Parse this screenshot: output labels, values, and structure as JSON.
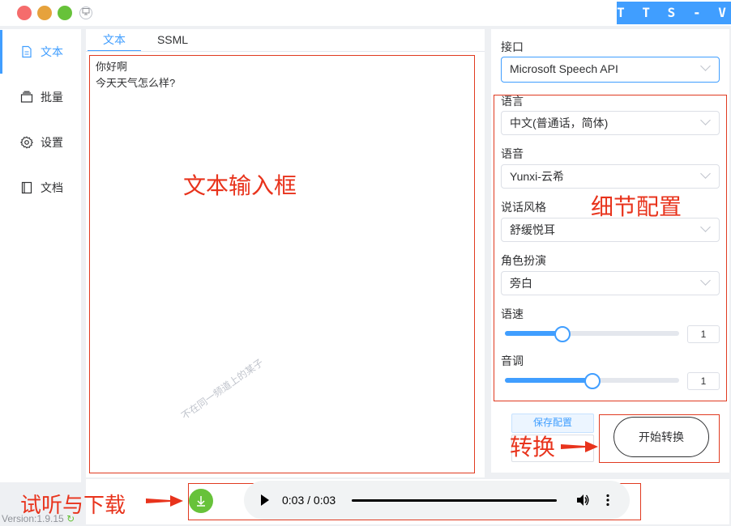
{
  "window": {
    "brand": "T T S - V U E"
  },
  "sidebar": {
    "items": [
      {
        "label": "文本",
        "icon": "document-icon"
      },
      {
        "label": "批量",
        "icon": "stack-icon"
      },
      {
        "label": "设置",
        "icon": "gear-icon"
      },
      {
        "label": "文档",
        "icon": "book-icon"
      }
    ],
    "version": "Version:1.9.15"
  },
  "editor": {
    "tabs": [
      "文本",
      "SSML"
    ],
    "text_lines": [
      "你好啊",
      "今天天气怎么样?"
    ],
    "watermark": "不在同一频道上的某子"
  },
  "config": {
    "api_label": "接口",
    "api_value": "Microsoft Speech API",
    "language_label": "语言",
    "language_value": "中文(普通话，简体)",
    "voice_label": "语音",
    "voice_value": "Yunxi-云希",
    "style_label": "说话风格",
    "style_value": "舒缓悦耳",
    "role_label": "角色扮演",
    "role_value": "旁白",
    "rate_label": "语速",
    "rate_value": "1",
    "rate_level": 0.33,
    "pitch_label": "音调",
    "pitch_value": "1",
    "pitch_level": 0.5,
    "save_label": "保存配置",
    "convert_label": "开始转换"
  },
  "player": {
    "time": "0:03 / 0:03",
    "progress": 1.0
  },
  "annotations": {
    "text_input": "文本输入框",
    "detail_config": "细节配置",
    "convert": "转换",
    "listen_download": "试听与下载"
  },
  "colors": {
    "accent": "#409eff",
    "annotation": "#e8331c",
    "download": "#67c23a"
  }
}
